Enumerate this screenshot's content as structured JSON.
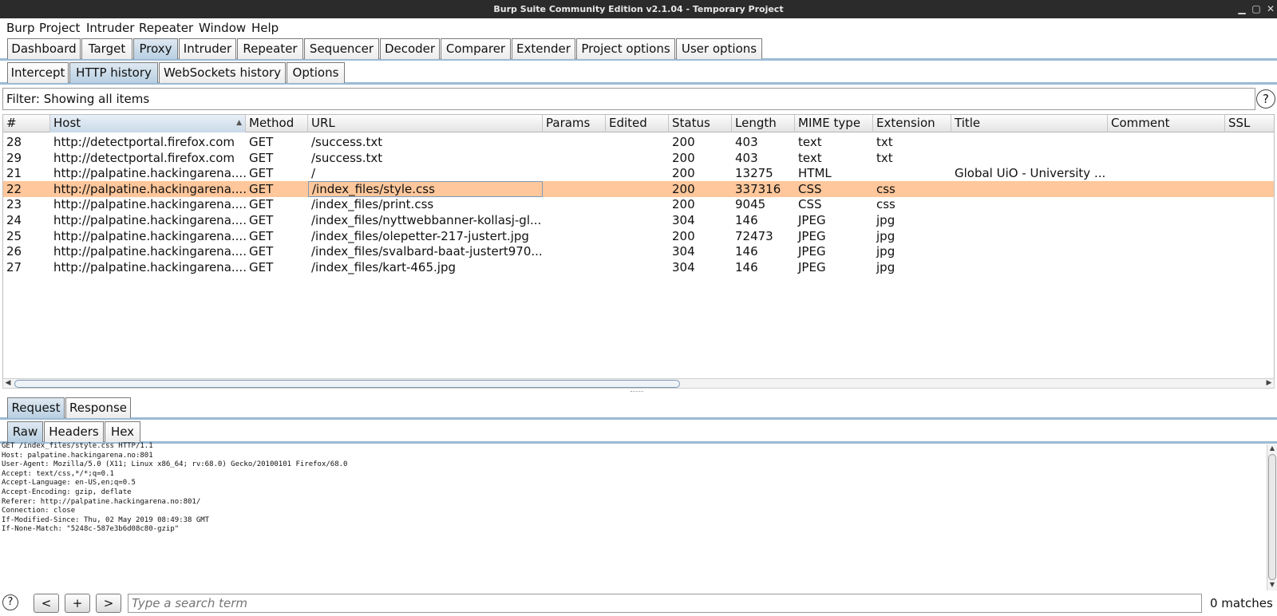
{
  "window": {
    "title": "Burp Suite Community Edition v2.1.04 - Temporary Project"
  },
  "menu": [
    "Burp",
    "Project",
    "Intruder",
    "Repeater",
    "Window",
    "Help"
  ],
  "main_tabs": [
    "Dashboard",
    "Target",
    "Proxy",
    "Intruder",
    "Repeater",
    "Sequencer",
    "Decoder",
    "Comparer",
    "Extender",
    "Project options",
    "User options"
  ],
  "main_tabs_active": "Proxy",
  "proxy_tabs": [
    "Intercept",
    "HTTP history",
    "WebSockets history",
    "Options"
  ],
  "proxy_tabs_active": "HTTP history",
  "filter": {
    "text": "Filter: Showing all items",
    "help": "?"
  },
  "table": {
    "columns": [
      "#",
      "Host",
      "Method",
      "URL",
      "Params",
      "Edited",
      "Status",
      "Length",
      "MIME type",
      "Extension",
      "Title",
      "Comment",
      "SSL"
    ],
    "sorted_column": "Host",
    "rows": [
      [
        "28",
        "http://detectportal.firefox.com",
        "GET",
        "/success.txt",
        "",
        "",
        "200",
        "403",
        "text",
        "txt",
        "",
        "",
        ""
      ],
      [
        "29",
        "http://detectportal.firefox.com",
        "GET",
        "/success.txt",
        "",
        "",
        "200",
        "403",
        "text",
        "txt",
        "",
        "",
        ""
      ],
      [
        "21",
        "http://palpatine.hackingarena....",
        "GET",
        "/",
        "",
        "",
        "200",
        "13275",
        "HTML",
        "",
        "Global UiO - University ...",
        "",
        ""
      ],
      [
        "22",
        "http://palpatine.hackingarena....",
        "GET",
        "/index_files/style.css",
        "",
        "",
        "200",
        "337316",
        "CSS",
        "css",
        "",
        "",
        ""
      ],
      [
        "23",
        "http://palpatine.hackingarena....",
        "GET",
        "/index_files/print.css",
        "",
        "",
        "200",
        "9045",
        "CSS",
        "css",
        "",
        "",
        ""
      ],
      [
        "24",
        "http://palpatine.hackingarena....",
        "GET",
        "/index_files/nyttwebbanner-kollasj-gl...",
        "",
        "",
        "304",
        "146",
        "JPEG",
        "jpg",
        "",
        "",
        ""
      ],
      [
        "25",
        "http://palpatine.hackingarena....",
        "GET",
        "/index_files/olepetter-217-justert.jpg",
        "",
        "",
        "200",
        "72473",
        "JPEG",
        "jpg",
        "",
        "",
        ""
      ],
      [
        "26",
        "http://palpatine.hackingarena....",
        "GET",
        "/index_files/svalbard-baat-justert970....",
        "",
        "",
        "304",
        "146",
        "JPEG",
        "jpg",
        "",
        "",
        ""
      ],
      [
        "27",
        "http://palpatine.hackingarena....",
        "GET",
        "/index_files/kart-465.jpg",
        "",
        "",
        "304",
        "146",
        "JPEG",
        "jpg",
        "",
        "",
        ""
      ]
    ],
    "selected_row": "22",
    "selected_color": "#ffc79b"
  },
  "message_tabs": [
    "Request",
    "Response"
  ],
  "message_tabs_active": "Request",
  "view_tabs": [
    "Raw",
    "Headers",
    "Hex"
  ],
  "view_tabs_active": "Raw",
  "raw_request": [
    "GET /index_files/style.css HTTP/1.1",
    "Host: palpatine.hackingarena.no:801",
    "User-Agent: Mozilla/5.0 (X11; Linux x86_64; rv:68.0) Gecko/20100101 Firefox/68.0",
    "Accept: text/css,*/*;q=0.1",
    "Accept-Language: en-US,en;q=0.5",
    "Accept-Encoding: gzip, deflate",
    "Referer: http://palpatine.hackingarena.no:801/",
    "Connection: close",
    "If-Modified-Since: Thu, 02 May 2019 08:49:38 GMT",
    "If-None-Match: \"5248c-587e3b6d08c80-gzip\""
  ],
  "search": {
    "help": "?",
    "prev_label": "<",
    "add_label": "+",
    "next_label": ">",
    "placeholder": "Type a search term",
    "matches": "0 matches"
  },
  "colors": {
    "tab_accent": "#9bbad4",
    "titlebar_bg": "#2b2b2b",
    "selected_row": "#ffc79b"
  }
}
